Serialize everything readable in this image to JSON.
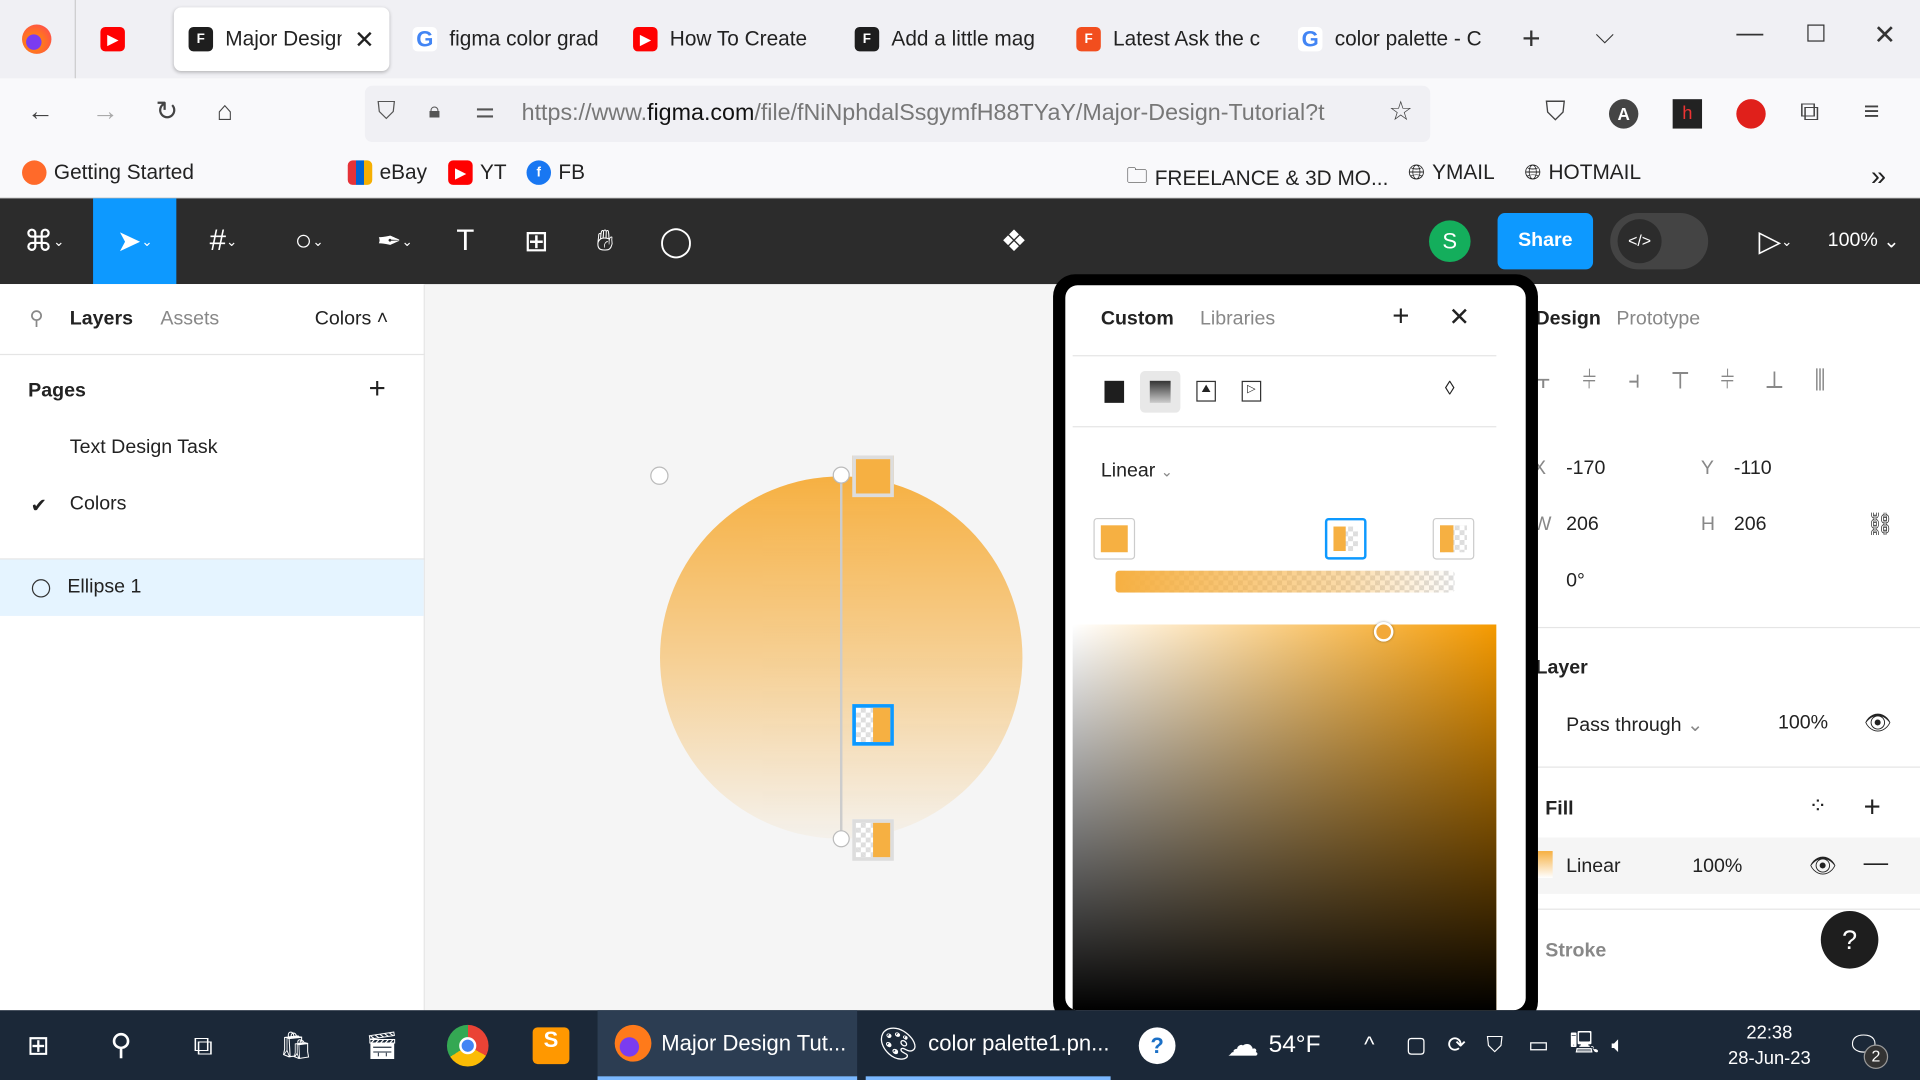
{
  "browser": {
    "tabs": [
      {
        "label": "",
        "icon": "youtube-icon"
      },
      {
        "label": "Major Design",
        "icon": "figma-icon",
        "active": true
      },
      {
        "label": "figma color grad",
        "icon": "google-icon"
      },
      {
        "label": "How To Create",
        "icon": "youtube-icon"
      },
      {
        "label": "Add a little mag",
        "icon": "figma-icon"
      },
      {
        "label": "Latest Ask the c",
        "icon": "figma-icon"
      },
      {
        "label": "color palette - C",
        "icon": "google-icon"
      }
    ],
    "url_prefix": "https://www.",
    "url_domain": "figma.com",
    "url_rest": "/file/fNiNphdalSsgymfH88TYaY/Major-Design-Tutorial?t",
    "bookmarks": [
      "Getting Started",
      "eBay",
      "YT",
      "FB",
      "FREELANCE & 3D MO...",
      "YMAIL",
      "HOTMAIL"
    ]
  },
  "figma": {
    "share_label": "Share",
    "avatar_initial": "S",
    "zoom": "100%",
    "left": {
      "tabs": [
        "Layers",
        "Assets"
      ],
      "page_dropdown": "Colors",
      "pages_title": "Pages",
      "pages": [
        "Text Design Task",
        "Colors"
      ],
      "layers": [
        "Ellipse 1"
      ]
    },
    "picker": {
      "tabs": [
        "Custom",
        "Libraries"
      ],
      "gradient_type": "Linear",
      "stops": [
        {
          "color": "#F6B042",
          "opacity": 100
        },
        {
          "color": "#F6B042",
          "opacity": 50
        },
        {
          "color": "#F6B042",
          "opacity": 0
        }
      ],
      "hue_color": "#F59A00"
    },
    "right": {
      "tabs": [
        "Design",
        "Prototype"
      ],
      "x_label": "X",
      "x": "-170",
      "y_label": "Y",
      "y": "-110",
      "w_label": "W",
      "w": "206",
      "h_label": "H",
      "h": "206",
      "rotation": "0°",
      "layer_title": "Layer",
      "blend": "Pass through",
      "layer_opacity": "100%",
      "fill_title": "Fill",
      "fill_type": "Linear",
      "fill_opacity": "100%",
      "stroke_title": "Stroke",
      "help": "?"
    }
  },
  "taskbar": {
    "apps": [
      "Major Design Tut...",
      "color palette1.pn..."
    ],
    "weather": "54°F",
    "time": "22:38",
    "date": "28-Jun-23",
    "notifications": "2"
  },
  "colors": {
    "accent": "#0D99FF",
    "orange": "#F6B042",
    "toolbar": "#2C2C2C",
    "taskbar": "#1B2838"
  }
}
